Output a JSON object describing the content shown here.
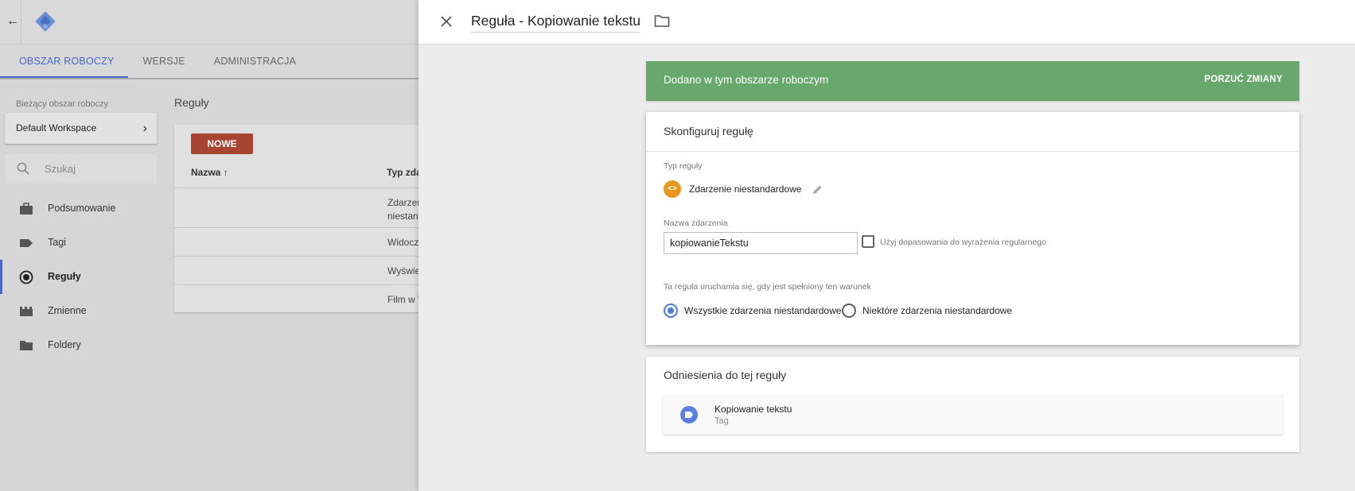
{
  "app": {
    "nav_tabs": [
      {
        "label": "OBSZAR ROBOCZY",
        "active": true
      },
      {
        "label": "WERSJE",
        "active": false
      },
      {
        "label": "ADMINISTRACJA",
        "active": false
      }
    ],
    "workspace": {
      "label": "Bieżący obszar roboczy",
      "current": "Default Workspace"
    },
    "search": {
      "placeholder": "Szukaj"
    },
    "sidebar": {
      "items": [
        {
          "label": "Podsumowanie",
          "icon": "briefcase-icon",
          "active": false
        },
        {
          "label": "Tagi",
          "icon": "tag-icon",
          "active": false
        },
        {
          "label": "Reguły",
          "icon": "trigger-icon",
          "active": true
        },
        {
          "label": "Zmienne",
          "icon": "variable-icon",
          "active": false
        },
        {
          "label": "Foldery",
          "icon": "folder-icon",
          "active": false
        }
      ]
    },
    "content": {
      "title": "Reguły",
      "new_button": "NOWE",
      "columns": {
        "name": "Nazwa",
        "type": "Typ zda"
      },
      "rows": [
        {
          "type": "Zdarzen\nniestanc"
        },
        {
          "type": "Widoczn"
        },
        {
          "type": "Wyświe"
        },
        {
          "type": "Film w Y"
        }
      ]
    }
  },
  "panel": {
    "title": "Reguła - Kopiowanie tekstu",
    "banner": {
      "text": "Dodano w tym obszarze roboczym",
      "action": "PORZUĆ ZMIANY",
      "color": "#68a86c"
    },
    "config": {
      "title": "Skonfiguruj regułę",
      "type_label": "Typ reguły",
      "type_value": "Zdarzenie niestandardowe",
      "type_badge": "<>",
      "event_name_label": "Nazwa zdarzenia",
      "event_name_value": "kopiowanieTekstu",
      "regex_label": "Użyj dopasowania do wyrażenia regularnego",
      "regex_checked": false,
      "condition_label": "Ta reguła uruchamia się, gdy jest spełniony ten warunek",
      "options": [
        {
          "label": "Wszystkie zdarzenia niestandardowe",
          "selected": true
        },
        {
          "label": "Niektóre zdarzenia niestandardowe",
          "selected": false
        }
      ]
    },
    "references": {
      "title": "Odniesienia do tej reguły",
      "items": [
        {
          "name": "Kopiowanie tekstu",
          "kind": "Tag"
        }
      ]
    }
  },
  "colors": {
    "accent": "#4967c9",
    "new_button": "#a84532",
    "trigger_badge": "#e8971f",
    "tag_icon": "#5b7fe0"
  }
}
